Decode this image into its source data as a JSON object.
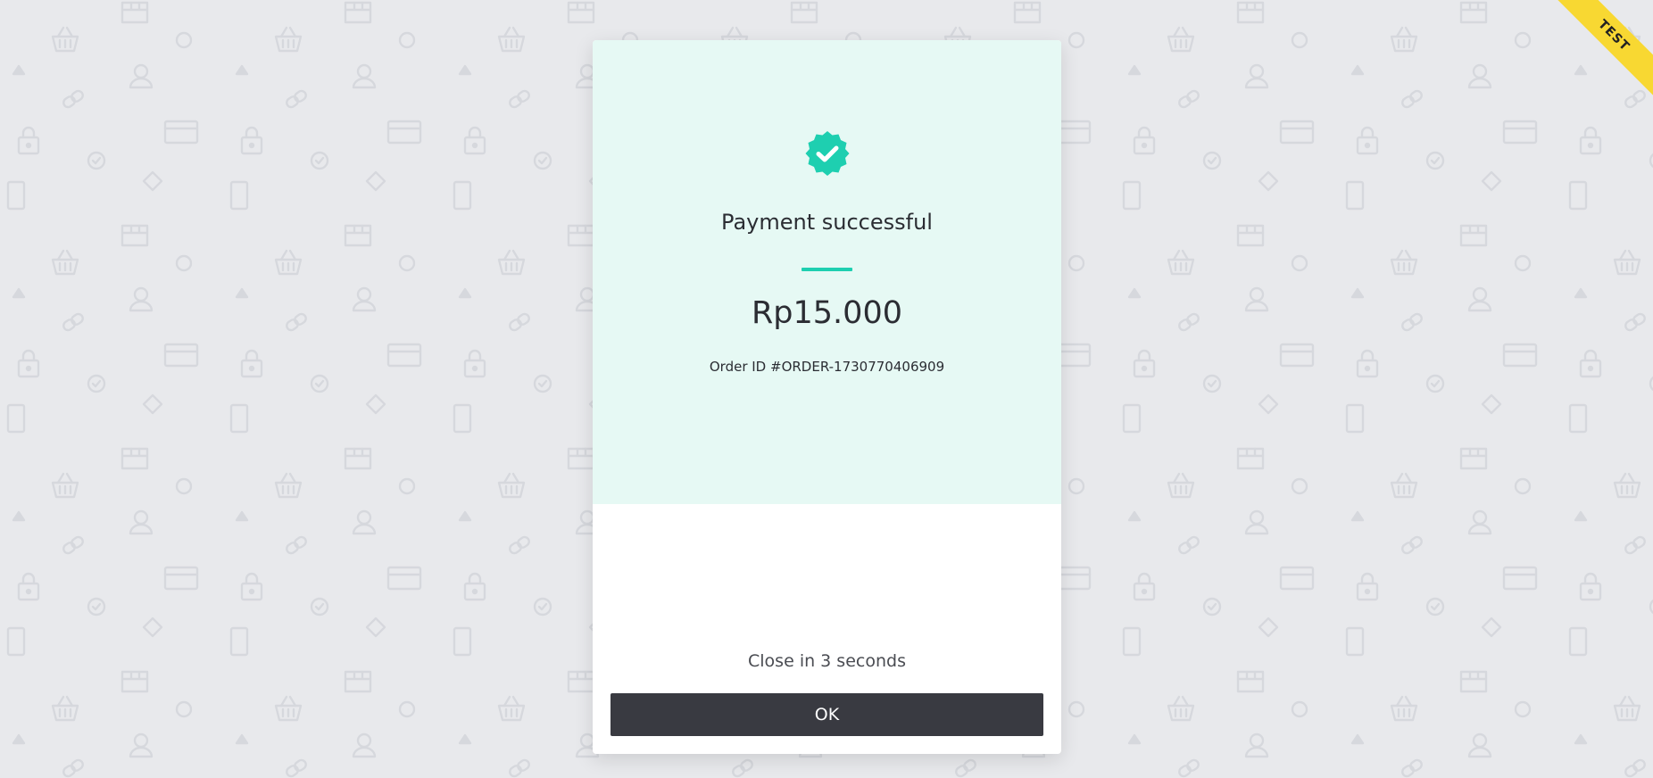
{
  "ribbon": {
    "label": "TEST",
    "color": "#f8d832"
  },
  "payment": {
    "title": "Payment successful",
    "amount": "Rp15.000",
    "order_id": "Order ID #ORDER-1730770406909",
    "icon": "check-badge-icon",
    "accent_color": "#1ecfb0"
  },
  "footer": {
    "countdown_text": "Close in 3 seconds",
    "ok_label": "OK",
    "button_color": "#393a41"
  },
  "background": {
    "color": "#e8e9ec",
    "pattern_icons": [
      "basket-icon",
      "store-icon",
      "circle-icon",
      "triangle-icon",
      "user-icon",
      "link-icon",
      "lock-icon",
      "card-icon",
      "check-circle-icon",
      "diamond-icon",
      "phone-icon"
    ]
  }
}
